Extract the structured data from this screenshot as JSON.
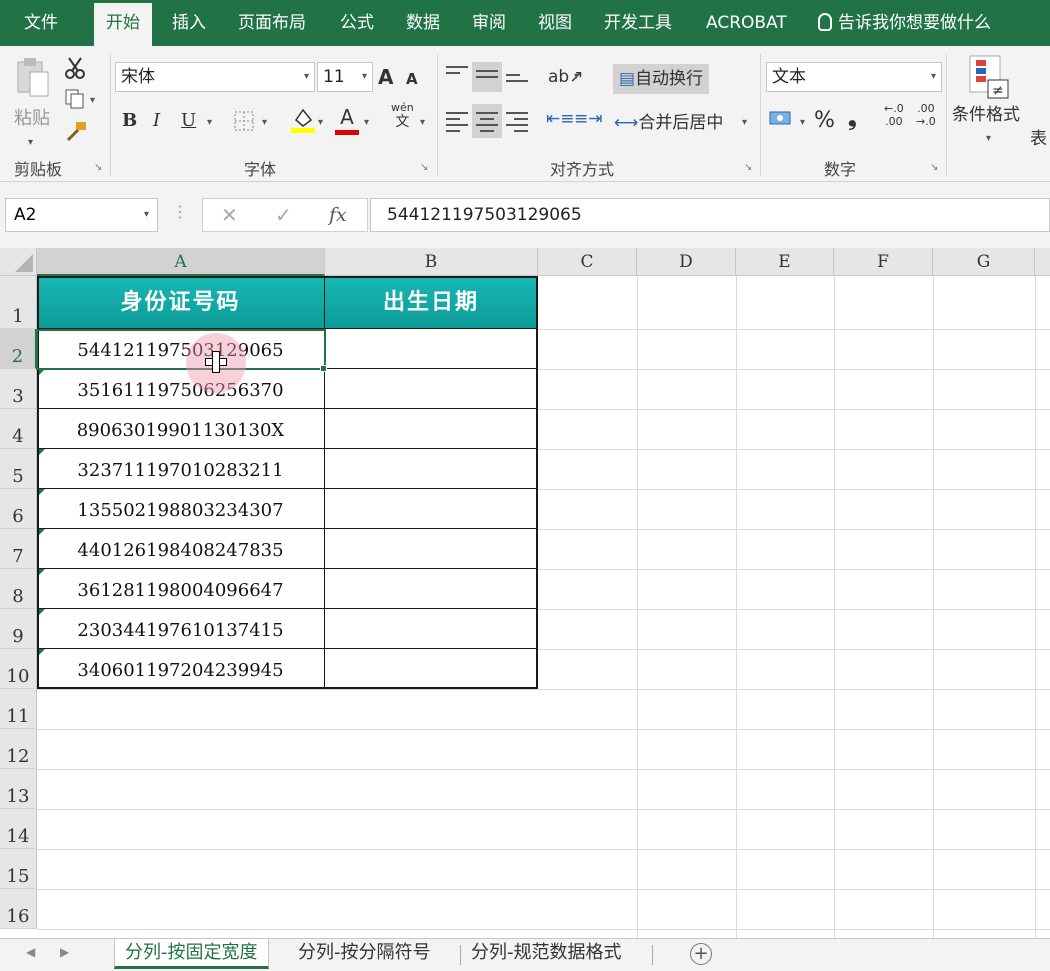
{
  "ribbon_tabs": [
    "文件",
    "开始",
    "插入",
    "页面布局",
    "公式",
    "数据",
    "审阅",
    "视图",
    "开发工具",
    "ACROBAT"
  ],
  "tell_me": "告诉我你想要做什么",
  "clipboard": {
    "paste_label": "粘贴",
    "group_label": "剪贴板"
  },
  "font": {
    "name": "宋体",
    "size": "11",
    "bold": "B",
    "italic": "I",
    "underline": "U",
    "grow": "A",
    "shrink": "A",
    "font_color_glyph": "A",
    "pinyin_top": "wén",
    "pinyin_bottom": "文",
    "group_label": "字体"
  },
  "alignment": {
    "wrap_text": "自动换行",
    "merge_center": "合并后居中",
    "group_label": "对齐方式"
  },
  "number": {
    "format": "文本",
    "percent": "%",
    "comma": "❟",
    "inc_top": "←.0",
    "inc_bottom": ".00",
    "dec_top": ".00",
    "dec_bottom": "→.0",
    "group_label": "数字"
  },
  "styles": {
    "conditional_format": "条件格式",
    "truncated": "表"
  },
  "formula_bar": {
    "name_box": "A2",
    "fx": "fx",
    "formula": "544121197503129065"
  },
  "columns": [
    "A",
    "B",
    "C",
    "D",
    "E",
    "F",
    "G"
  ],
  "rows": [
    "1",
    "2",
    "3",
    "4",
    "5",
    "6",
    "7",
    "8",
    "9",
    "10",
    "11",
    "12",
    "13",
    "14",
    "15",
    "16"
  ],
  "table": {
    "headers": [
      "身份证号码",
      "出生日期"
    ],
    "id_numbers": [
      "544121197503129065",
      "351611197506256370",
      "89063019901130130X",
      "323711197010283211",
      "135502198803234307",
      "440126198408247835",
      "361281198004096647",
      "230344197610137415",
      "340601197204239945"
    ]
  },
  "sheets": [
    "分列-按固定宽度",
    "分列-按分隔符号",
    "分列-规范数据格式"
  ],
  "colors": {
    "excel_green": "#217346",
    "header_teal": "#12aaa6"
  }
}
